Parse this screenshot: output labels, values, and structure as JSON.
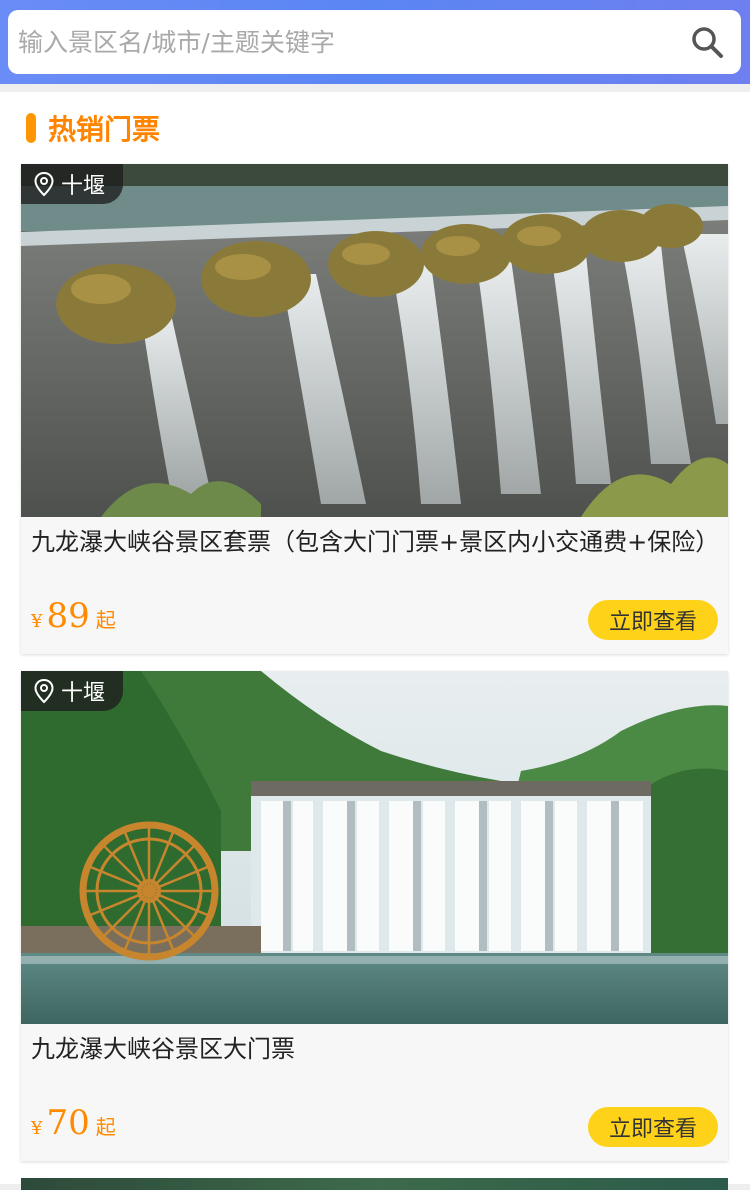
{
  "search": {
    "placeholder": "输入景区名/城市/主题关键字"
  },
  "section": {
    "title": "热销门票",
    "accent_color": "#ff9500"
  },
  "tickets": [
    {
      "location": "十堰",
      "title": "九龙瀑大峡谷景区套票（包含大门门票+景区内小交通费+保险）",
      "currency": "¥",
      "price": "89",
      "price_suffix": "起",
      "button_label": "立即查看",
      "image": "dragon-head-waterfall-photo"
    },
    {
      "location": "十堰",
      "title": "九龙瀑大峡谷景区大门票",
      "currency": "¥",
      "price": "70",
      "price_suffix": "起",
      "button_label": "立即查看",
      "image": "waterwheel-waterfall-photo"
    }
  ],
  "colors": {
    "header_blue": "#5a86f3",
    "price_orange": "#ff8a00",
    "button_yellow": "#ffd21a"
  }
}
